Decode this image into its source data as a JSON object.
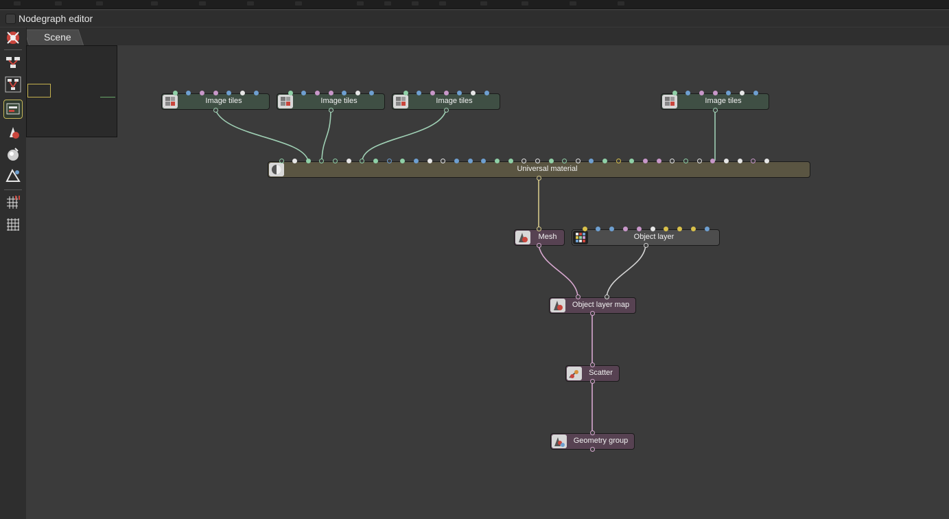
{
  "window": {
    "title": "Nodegraph editor"
  },
  "tabs": [
    {
      "label": "Scene"
    }
  ],
  "toolbar": {
    "buttons": [
      {
        "icon": "octane-logo-icon"
      },
      {
        "icon": "node-tree-icon"
      },
      {
        "icon": "node-tree-expand-icon"
      },
      {
        "icon": "minimap-toggle-icon",
        "active": true
      },
      {
        "icon": "material-ball-icon"
      },
      {
        "icon": "render-target-icon"
      },
      {
        "icon": "scene-item-icon"
      },
      {
        "icon": "grid-snap-icon"
      },
      {
        "icon": "grid-icon"
      }
    ]
  },
  "colors": {
    "pin_green": "#8fd0a6",
    "pin_blue": "#6e9fd0",
    "pin_pink": "#c897c9",
    "pin_white": "#e6e6e6",
    "pin_yellow": "#d8c04a",
    "wire_tex": "#9fcfb4",
    "wire_mat": "#d6c98a",
    "wire_geo": "#d8a8d0",
    "wire_layer": "#d4d4d4"
  },
  "nodes": [
    {
      "id": "tile1",
      "label": "Image tiles",
      "kind": "tile",
      "icon": "image-tiles-icon"
    },
    {
      "id": "tile2",
      "label": "Image tiles",
      "kind": "tile",
      "icon": "image-tiles-icon"
    },
    {
      "id": "tile3",
      "label": "Image tiles",
      "kind": "tile",
      "icon": "image-tiles-icon"
    },
    {
      "id": "tile4",
      "label": "Image tiles",
      "kind": "tile",
      "icon": "image-tiles-icon"
    },
    {
      "id": "mat",
      "label": "Universal material",
      "kind": "mat",
      "icon": "universal-material-icon"
    },
    {
      "id": "mesh",
      "label": "Mesh",
      "kind": "geo",
      "icon": "mesh-icon"
    },
    {
      "id": "layer",
      "label": "Object layer",
      "kind": "lay",
      "icon": "object-layer-icon"
    },
    {
      "id": "olm",
      "label": "Object layer map",
      "kind": "geo",
      "icon": "object-layer-map-icon"
    },
    {
      "id": "scatter",
      "label": "Scatter",
      "kind": "geo",
      "icon": "scatter-icon"
    },
    {
      "id": "group",
      "label": "Geometry group",
      "kind": "geo",
      "icon": "geometry-group-icon"
    }
  ]
}
